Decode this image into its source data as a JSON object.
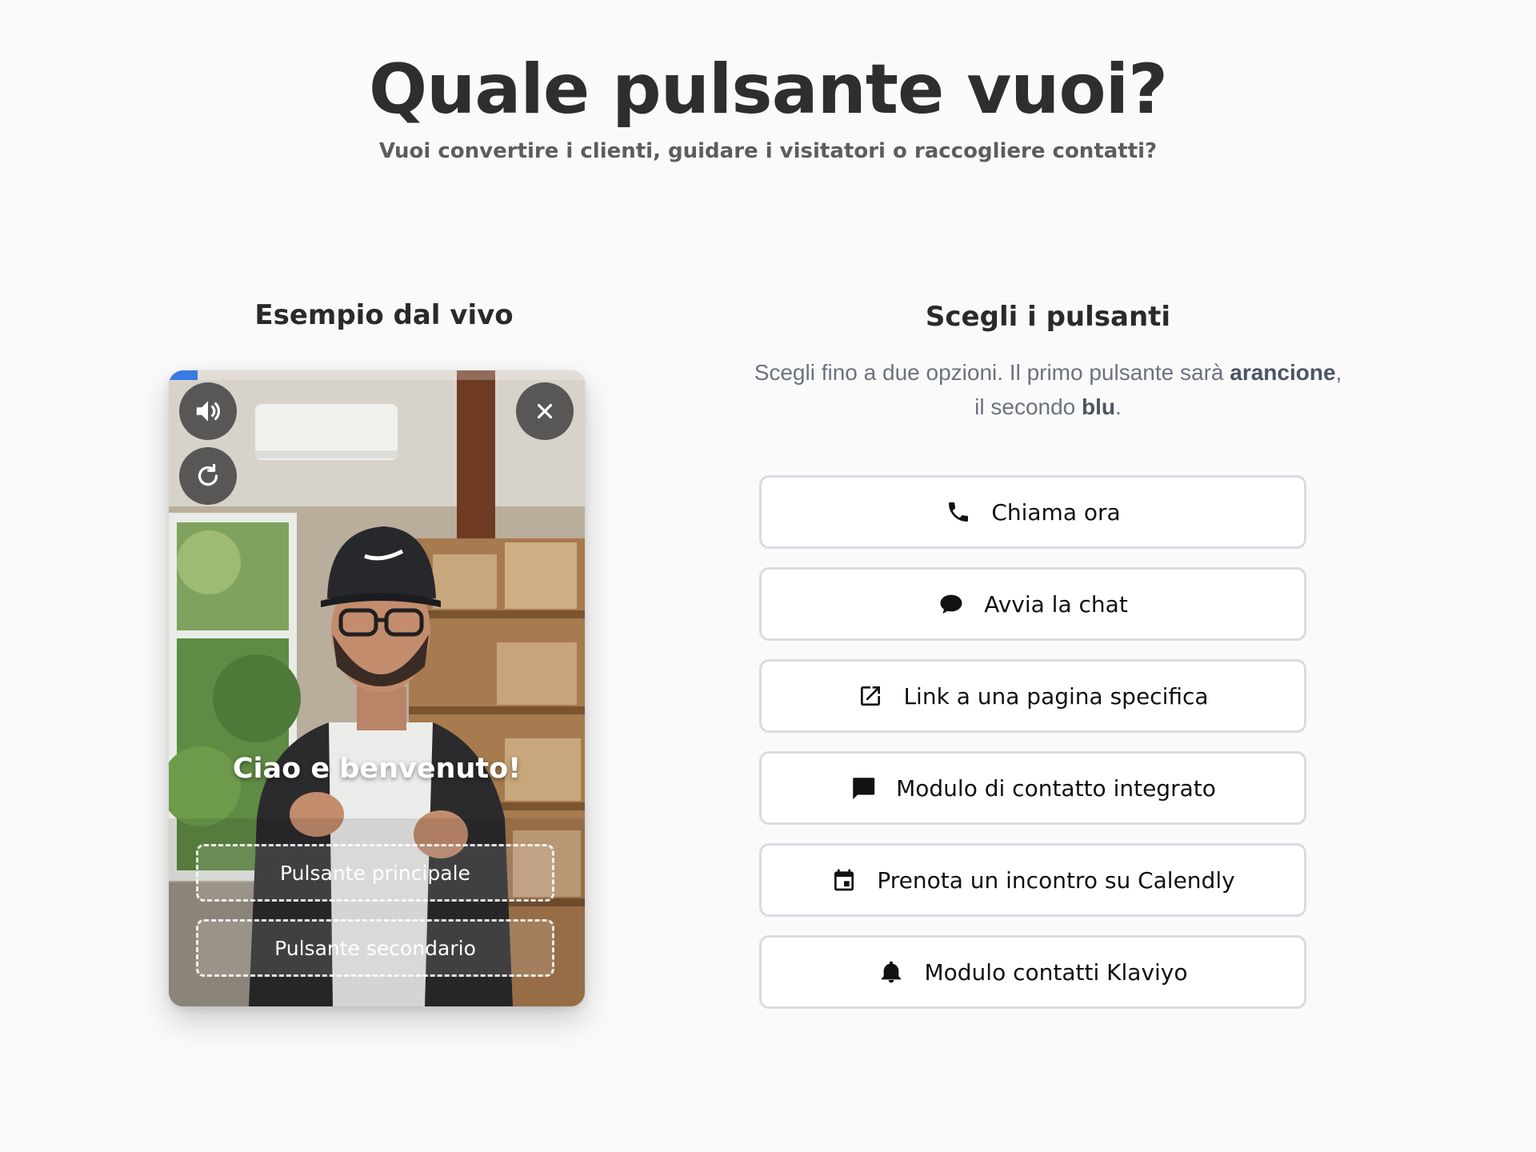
{
  "header": {
    "title": "Quale pulsante vuoi?",
    "subtitle": "Vuoi convertire i clienti, guidare i visitatori o raccogliere contatti?"
  },
  "live_example": {
    "heading": "Esempio dal vivo",
    "progress_fraction": 0.07,
    "caption": "Ciao e benvenuto!",
    "primary_button": "Pulsante principale",
    "secondary_button": "Pulsante secondario",
    "controls": {
      "sound_icon": "speaker-icon",
      "replay_icon": "replay-icon",
      "close_icon": "close-icon"
    },
    "colors": {
      "progress": "#3a79e6"
    }
  },
  "chooser": {
    "heading": "Scegli i pulsanti",
    "desc_part1": "Scegli fino a due opzioni. Il primo pulsante sarà ",
    "desc_bold1": "arancione",
    "desc_part2": ",",
    "desc_part3": "il secondo ",
    "desc_bold2": "blu",
    "desc_part4": ".",
    "options": [
      {
        "label": "Chiama ora",
        "icon": "phone-icon"
      },
      {
        "label": "Avvia la chat",
        "icon": "chat-bubble-icon"
      },
      {
        "label": "Link a una pagina specifica",
        "icon": "external-link-icon"
      },
      {
        "label": "Modulo di contatto integrato",
        "icon": "message-icon"
      },
      {
        "label": "Prenota un incontro su Calendly",
        "icon": "calendar-icon"
      },
      {
        "label": "Modulo contatti Klaviyo",
        "icon": "bell-icon"
      }
    ]
  }
}
